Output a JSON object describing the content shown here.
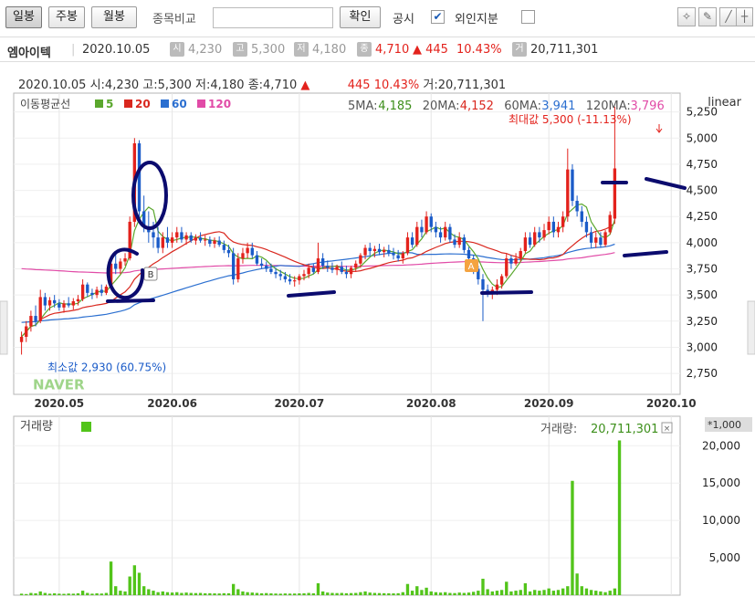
{
  "toolbar": {
    "period_buttons": [
      {
        "label": "일봉",
        "active": true
      },
      {
        "label": "주봉",
        "active": false
      },
      {
        "label": "월봉",
        "active": false
      }
    ],
    "compare_label": "종목비교",
    "compare_input_value": "",
    "confirm_label": "확인",
    "disclosure_label": "공시",
    "disclosure_checked": true,
    "foreign_label": "외인지분",
    "foreign_checked": false,
    "tool_icons": [
      "lightbulb-icon",
      "pencil-icon",
      "draw-line-icon",
      "crosshair-icon"
    ]
  },
  "stock": {
    "name": "엠아이텍",
    "date": "2020.10.05",
    "open_badge": "시",
    "open": "4,230",
    "high_badge": "고",
    "high": "5,300",
    "low_badge": "저",
    "low": "4,180",
    "close_badge": "종",
    "close": "4,710",
    "change": "▲ 445",
    "change_pct": "10.43%",
    "volume_badge": "거",
    "volume": "20,711,301",
    "up_color": "#e3221c"
  },
  "info_line": {
    "date": "2020.10.05",
    "open": "시:4,230",
    "high": "고:5,300",
    "low": "저:4,180",
    "close": "종:4,710",
    "change": "▲",
    "change_value": "445",
    "change_pct": "10.43%",
    "volume": "거:20,711,301"
  },
  "chart_data": [
    {
      "type": "candlestick",
      "title": "",
      "scale_label": "linear",
      "ma_label": "이동평균선",
      "legend": [
        {
          "name": "5",
          "color": "#5aa72d"
        },
        {
          "name": "20",
          "color": "#d9271e"
        },
        {
          "name": "60",
          "color": "#2b6fd0"
        },
        {
          "name": "120",
          "color": "#e14ba7"
        }
      ],
      "ma_values": [
        {
          "label": "5MA:",
          "value": "4,185",
          "color": "#3d8f1b"
        },
        {
          "label": "20MA:",
          "value": "4,152",
          "color": "#d9271e"
        },
        {
          "label": "60MA:",
          "value": "3,941",
          "color": "#2b6fd0"
        },
        {
          "label": "120MA:",
          "value": "3,796",
          "color": "#e14ba7"
        }
      ],
      "max_label": "최대값 5,300 (-11.13%)",
      "min_label": "최소값 2,930 (60.75%)",
      "watermark": "NAVER",
      "marker_a": "A",
      "marker_b": "B",
      "y_ticks": [
        "5,250",
        "5,000",
        "4,750",
        "4,500",
        "4,250",
        "4,000",
        "3,750",
        "3,500",
        "3,250",
        "3,000",
        "2,750"
      ],
      "y_tick_values": [
        5250,
        5000,
        4750,
        4500,
        4250,
        4000,
        3750,
        3500,
        3250,
        3000,
        2750
      ],
      "ylim": [
        2550,
        5430
      ],
      "x_ticks": [
        "2020.05",
        "2020.06",
        "2020.07",
        "2020.08",
        "2020.09",
        "2020.10"
      ],
      "x_tick_index": [
        8,
        32,
        59,
        87,
        112,
        138
      ],
      "n_days": 140,
      "candles": [
        {
          "o": 3050,
          "h": 3150,
          "l": 2930,
          "c": 3100
        },
        {
          "o": 3100,
          "h": 3250,
          "l": 3050,
          "c": 3200
        },
        {
          "o": 3200,
          "h": 3350,
          "l": 3150,
          "c": 3300
        },
        {
          "o": 3300,
          "h": 3400,
          "l": 3200,
          "c": 3250
        },
        {
          "o": 3250,
          "h": 3550,
          "l": 3230,
          "c": 3480
        },
        {
          "o": 3480,
          "h": 3520,
          "l": 3350,
          "c": 3400
        },
        {
          "o": 3400,
          "h": 3480,
          "l": 3350,
          "c": 3450
        },
        {
          "o": 3450,
          "h": 3500,
          "l": 3380,
          "c": 3420
        },
        {
          "o": 3420,
          "h": 3460,
          "l": 3350,
          "c": 3380
        },
        {
          "o": 3380,
          "h": 3450,
          "l": 3330,
          "c": 3420
        },
        {
          "o": 3420,
          "h": 3480,
          "l": 3380,
          "c": 3400
        },
        {
          "o": 3400,
          "h": 3470,
          "l": 3360,
          "c": 3440
        },
        {
          "o": 3440,
          "h": 3500,
          "l": 3400,
          "c": 3460
        },
        {
          "o": 3460,
          "h": 3650,
          "l": 3440,
          "c": 3600
        },
        {
          "o": 3600,
          "h": 3620,
          "l": 3480,
          "c": 3520
        },
        {
          "o": 3520,
          "h": 3560,
          "l": 3460,
          "c": 3500
        },
        {
          "o": 3500,
          "h": 3580,
          "l": 3470,
          "c": 3550
        },
        {
          "o": 3550,
          "h": 3600,
          "l": 3490,
          "c": 3520
        },
        {
          "o": 3520,
          "h": 3600,
          "l": 3500,
          "c": 3580
        },
        {
          "o": 3580,
          "h": 3850,
          "l": 3560,
          "c": 3800
        },
        {
          "o": 3800,
          "h": 3900,
          "l": 3700,
          "c": 3750
        },
        {
          "o": 3750,
          "h": 3850,
          "l": 3700,
          "c": 3820
        },
        {
          "o": 3820,
          "h": 3900,
          "l": 3780,
          "c": 3850
        },
        {
          "o": 3850,
          "h": 4250,
          "l": 3830,
          "c": 4200
        },
        {
          "o": 4200,
          "h": 5000,
          "l": 4150,
          "c": 4950
        },
        {
          "o": 4950,
          "h": 4980,
          "l": 4200,
          "c": 4300
        },
        {
          "o": 4300,
          "h": 4450,
          "l": 4100,
          "c": 4150
        },
        {
          "o": 4150,
          "h": 4300,
          "l": 4000,
          "c": 4100
        },
        {
          "o": 4100,
          "h": 4200,
          "l": 3950,
          "c": 4050
        },
        {
          "o": 4050,
          "h": 4150,
          "l": 3900,
          "c": 3950
        },
        {
          "o": 3950,
          "h": 4100,
          "l": 3900,
          "c": 4050
        },
        {
          "o": 4050,
          "h": 4150,
          "l": 3950,
          "c": 4000
        },
        {
          "o": 4000,
          "h": 4100,
          "l": 3950,
          "c": 4050
        },
        {
          "o": 4050,
          "h": 4150,
          "l": 4000,
          "c": 4100
        },
        {
          "o": 4100,
          "h": 4150,
          "l": 4000,
          "c": 4030
        },
        {
          "o": 4030,
          "h": 4100,
          "l": 3980,
          "c": 4070
        },
        {
          "o": 4070,
          "h": 4100,
          "l": 4000,
          "c": 4020
        },
        {
          "o": 4020,
          "h": 4080,
          "l": 3980,
          "c": 4050
        },
        {
          "o": 4050,
          "h": 4100,
          "l": 4000,
          "c": 4020
        },
        {
          "o": 4020,
          "h": 4070,
          "l": 3970,
          "c": 4030
        },
        {
          "o": 4030,
          "h": 4060,
          "l": 3960,
          "c": 3990
        },
        {
          "o": 3990,
          "h": 4050,
          "l": 3950,
          "c": 4020
        },
        {
          "o": 4020,
          "h": 4060,
          "l": 3960,
          "c": 3980
        },
        {
          "o": 3980,
          "h": 4020,
          "l": 3900,
          "c": 3930
        },
        {
          "o": 3930,
          "h": 3980,
          "l": 3860,
          "c": 3900
        },
        {
          "o": 3900,
          "h": 3950,
          "l": 3600,
          "c": 3650
        },
        {
          "o": 3650,
          "h": 3900,
          "l": 3620,
          "c": 3850
        },
        {
          "o": 3850,
          "h": 3950,
          "l": 3800,
          "c": 3900
        },
        {
          "o": 3900,
          "h": 4000,
          "l": 3850,
          "c": 3950
        },
        {
          "o": 3950,
          "h": 4000,
          "l": 3850,
          "c": 3880
        },
        {
          "o": 3880,
          "h": 3920,
          "l": 3780,
          "c": 3800
        },
        {
          "o": 3800,
          "h": 3850,
          "l": 3750,
          "c": 3780
        },
        {
          "o": 3780,
          "h": 3820,
          "l": 3720,
          "c": 3750
        },
        {
          "o": 3750,
          "h": 3800,
          "l": 3700,
          "c": 3720
        },
        {
          "o": 3720,
          "h": 3760,
          "l": 3660,
          "c": 3700
        },
        {
          "o": 3700,
          "h": 3740,
          "l": 3640,
          "c": 3680
        },
        {
          "o": 3680,
          "h": 3720,
          "l": 3620,
          "c": 3650
        },
        {
          "o": 3650,
          "h": 3700,
          "l": 3600,
          "c": 3630
        },
        {
          "o": 3630,
          "h": 3680,
          "l": 3580,
          "c": 3640
        },
        {
          "o": 3640,
          "h": 3700,
          "l": 3600,
          "c": 3680
        },
        {
          "o": 3680,
          "h": 3740,
          "l": 3640,
          "c": 3700
        },
        {
          "o": 3700,
          "h": 3800,
          "l": 3660,
          "c": 3760
        },
        {
          "o": 3760,
          "h": 3800,
          "l": 3700,
          "c": 3720
        },
        {
          "o": 3720,
          "h": 4000,
          "l": 3700,
          "c": 3850
        },
        {
          "o": 3850,
          "h": 3900,
          "l": 3750,
          "c": 3780
        },
        {
          "o": 3780,
          "h": 3830,
          "l": 3720,
          "c": 3760
        },
        {
          "o": 3760,
          "h": 3810,
          "l": 3710,
          "c": 3740
        },
        {
          "o": 3740,
          "h": 3790,
          "l": 3690,
          "c": 3770
        },
        {
          "o": 3770,
          "h": 3820,
          "l": 3700,
          "c": 3720
        },
        {
          "o": 3720,
          "h": 3780,
          "l": 3660,
          "c": 3700
        },
        {
          "o": 3700,
          "h": 3780,
          "l": 3660,
          "c": 3760
        },
        {
          "o": 3760,
          "h": 3830,
          "l": 3720,
          "c": 3800
        },
        {
          "o": 3800,
          "h": 3900,
          "l": 3760,
          "c": 3880
        },
        {
          "o": 3880,
          "h": 3980,
          "l": 3840,
          "c": 3950
        },
        {
          "o": 3950,
          "h": 4000,
          "l": 3880,
          "c": 3920
        },
        {
          "o": 3920,
          "h": 3970,
          "l": 3860,
          "c": 3940
        },
        {
          "o": 3940,
          "h": 3990,
          "l": 3880,
          "c": 3910
        },
        {
          "o": 3910,
          "h": 3960,
          "l": 3860,
          "c": 3930
        },
        {
          "o": 3930,
          "h": 3980,
          "l": 3870,
          "c": 3900
        },
        {
          "o": 3900,
          "h": 3950,
          "l": 3840,
          "c": 3880
        },
        {
          "o": 3880,
          "h": 3930,
          "l": 3820,
          "c": 3850
        },
        {
          "o": 3850,
          "h": 3920,
          "l": 3800,
          "c": 3900
        },
        {
          "o": 3900,
          "h": 4100,
          "l": 3880,
          "c": 4050
        },
        {
          "o": 4050,
          "h": 4100,
          "l": 3950,
          "c": 3980
        },
        {
          "o": 3980,
          "h": 4200,
          "l": 3960,
          "c": 4150
        },
        {
          "o": 4150,
          "h": 4220,
          "l": 4050,
          "c": 4100
        },
        {
          "o": 4100,
          "h": 4300,
          "l": 4080,
          "c": 4250
        },
        {
          "o": 4250,
          "h": 4280,
          "l": 4100,
          "c": 4150
        },
        {
          "o": 4150,
          "h": 4200,
          "l": 4050,
          "c": 4100
        },
        {
          "o": 4100,
          "h": 4150,
          "l": 4000,
          "c": 4050
        },
        {
          "o": 4050,
          "h": 4200,
          "l": 4020,
          "c": 4150
        },
        {
          "o": 4150,
          "h": 4180,
          "l": 4000,
          "c": 4030
        },
        {
          "o": 4030,
          "h": 4080,
          "l": 3950,
          "c": 3980
        },
        {
          "o": 3980,
          "h": 4100,
          "l": 3950,
          "c": 4050
        },
        {
          "o": 4050,
          "h": 4080,
          "l": 3900,
          "c": 3930
        },
        {
          "o": 3930,
          "h": 3960,
          "l": 3800,
          "c": 3850
        },
        {
          "o": 3850,
          "h": 3880,
          "l": 3700,
          "c": 3750
        },
        {
          "o": 3750,
          "h": 3780,
          "l": 3600,
          "c": 3650
        },
        {
          "o": 3650,
          "h": 3700,
          "l": 3250,
          "c": 3550
        },
        {
          "o": 3550,
          "h": 3600,
          "l": 3480,
          "c": 3520
        },
        {
          "o": 3520,
          "h": 3580,
          "l": 3460,
          "c": 3550
        },
        {
          "o": 3550,
          "h": 3650,
          "l": 3500,
          "c": 3600
        },
        {
          "o": 3600,
          "h": 3700,
          "l": 3560,
          "c": 3680
        },
        {
          "o": 3680,
          "h": 3900,
          "l": 3660,
          "c": 3850
        },
        {
          "o": 3850,
          "h": 3880,
          "l": 3750,
          "c": 3800
        },
        {
          "o": 3800,
          "h": 3900,
          "l": 3780,
          "c": 3850
        },
        {
          "o": 3850,
          "h": 3950,
          "l": 3820,
          "c": 3920
        },
        {
          "o": 3920,
          "h": 4100,
          "l": 3900,
          "c": 4050
        },
        {
          "o": 4050,
          "h": 4100,
          "l": 3950,
          "c": 3980
        },
        {
          "o": 3980,
          "h": 4150,
          "l": 3960,
          "c": 4100
        },
        {
          "o": 4100,
          "h": 4150,
          "l": 4000,
          "c": 4050
        },
        {
          "o": 4050,
          "h": 4180,
          "l": 4020,
          "c": 4120
        },
        {
          "o": 4120,
          "h": 4250,
          "l": 4080,
          "c": 4200
        },
        {
          "o": 4200,
          "h": 4250,
          "l": 4050,
          "c": 4100
        },
        {
          "o": 4100,
          "h": 4200,
          "l": 4050,
          "c": 4150
        },
        {
          "o": 4150,
          "h": 4300,
          "l": 4100,
          "c": 4250
        },
        {
          "o": 4250,
          "h": 4900,
          "l": 4200,
          "c": 4700
        },
        {
          "o": 4700,
          "h": 4750,
          "l": 4350,
          "c": 4400
        },
        {
          "o": 4400,
          "h": 4450,
          "l": 4250,
          "c": 4300
        },
        {
          "o": 4300,
          "h": 4350,
          "l": 4150,
          "c": 4200
        },
        {
          "o": 4200,
          "h": 4250,
          "l": 4050,
          "c": 4100
        },
        {
          "o": 4100,
          "h": 4150,
          "l": 3950,
          "c": 4000
        },
        {
          "o": 4000,
          "h": 4100,
          "l": 3950,
          "c": 4050
        },
        {
          "o": 4050,
          "h": 4100,
          "l": 3950,
          "c": 3980
        },
        {
          "o": 3980,
          "h": 4120,
          "l": 3960,
          "c": 4100
        },
        {
          "o": 4100,
          "h": 4300,
          "l": 4080,
          "c": 4265
        },
        {
          "o": 4230,
          "h": 5300,
          "l": 4180,
          "c": 4710
        }
      ]
    },
    {
      "type": "bar",
      "title": "거래량",
      "unit_label": "*1,000",
      "last_value_label": "거래량:",
      "last_value": "20,711,301",
      "y_ticks": [
        "20,000",
        "15,000",
        "10,000",
        "5,000"
      ],
      "y_tick_values": [
        20000,
        15000,
        10000,
        5000
      ],
      "ylim": [
        0,
        21500
      ],
      "color": "#52c41a",
      "values_k": [
        200,
        150,
        300,
        250,
        500,
        300,
        200,
        250,
        200,
        180,
        220,
        200,
        250,
        600,
        300,
        200,
        250,
        220,
        300,
        4500,
        1200,
        600,
        500,
        2500,
        4000,
        3000,
        1200,
        800,
        600,
        400,
        500,
        400,
        350,
        400,
        300,
        350,
        300,
        280,
        300,
        250,
        260,
        240,
        230,
        260,
        250,
        1500,
        800,
        500,
        400,
        350,
        300,
        250,
        280,
        240,
        220,
        200,
        230,
        210,
        220,
        240,
        250,
        300,
        250,
        1600,
        500,
        350,
        300,
        280,
        300,
        260,
        280,
        300,
        400,
        500,
        350,
        300,
        280,
        260,
        250,
        240,
        260,
        400,
        1500,
        600,
        1200,
        700,
        1000,
        500,
        400,
        350,
        400,
        300,
        280,
        350,
        300,
        350,
        450,
        600,
        2200,
        800,
        500,
        600,
        700,
        1800,
        500,
        600,
        700,
        1600,
        500,
        700,
        600,
        700,
        900,
        600,
        700,
        900,
        1200,
        15300,
        2900,
        1200,
        900,
        700,
        600,
        500,
        400,
        600,
        900,
        20711
      ]
    }
  ]
}
